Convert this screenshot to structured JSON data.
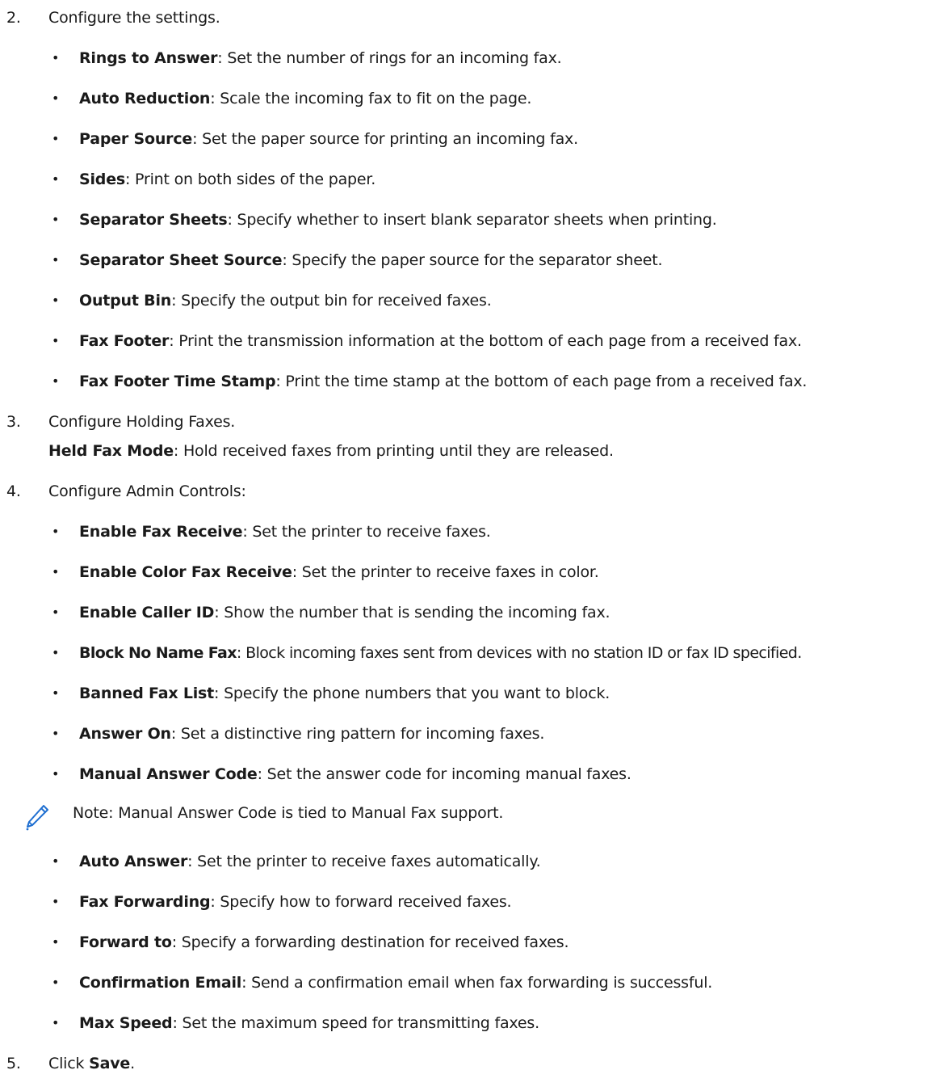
{
  "steps": [
    {
      "num": "2.",
      "text": "Configure the settings."
    },
    {
      "num": "3.",
      "text": "Configure Holding Faxes."
    },
    {
      "num": "4.",
      "text": "Configure Admin Controls:"
    },
    {
      "num": "5.",
      "text_before": "Click ",
      "term": "Save",
      "text_after": "."
    }
  ],
  "settings": [
    {
      "term": "Rings to Answer",
      "desc": ": Set the number of rings for an incoming fax."
    },
    {
      "term": "Auto Reduction",
      "desc": ": Scale the incoming fax to fit on the page."
    },
    {
      "term": "Paper Source",
      "desc": ": Set the paper source for printing an incoming fax."
    },
    {
      "term": "Sides",
      "desc": ": Print on both sides of the paper."
    },
    {
      "term": "Separator Sheets",
      "desc": ": Specify whether to insert blank separator sheets when printing."
    },
    {
      "term": "Separator Sheet Source",
      "desc": ": Specify the paper source for the separator sheet."
    },
    {
      "term": "Output Bin",
      "desc": ": Specify the output bin for received faxes."
    },
    {
      "term": "Fax Footer",
      "desc": ": Print the transmission information at the bottom of each page from a received fax."
    },
    {
      "term": "Fax Footer Time Stamp",
      "desc": ": Print the time stamp at the bottom of each page from a received fax."
    }
  ],
  "holding": {
    "term": "Held Fax Mode",
    "desc": ": Hold received faxes from printing until they are released."
  },
  "admin": [
    {
      "term": "Enable Fax Receive",
      "desc": ": Set the printer to receive faxes."
    },
    {
      "term": "Enable Color Fax Receive",
      "desc": ": Set the printer to receive faxes in color."
    },
    {
      "term": "Enable Caller ID",
      "desc": ": Show the number that is sending the incoming fax."
    },
    {
      "term": "Block No Name Fax",
      "desc": ": Block incoming faxes sent from devices with no station ID or fax ID specified."
    },
    {
      "term": "Banned Fax List",
      "desc": ": Specify the phone numbers that you want to block."
    },
    {
      "term": "Answer On",
      "desc": ": Set a distinctive ring pattern for incoming faxes."
    },
    {
      "term": "Manual Answer Code",
      "desc": ": Set the answer code for incoming manual faxes."
    }
  ],
  "note": {
    "icon": "pencil-note-icon",
    "text": "Note: Manual Answer Code is tied to Manual Fax support."
  },
  "admin_more": [
    {
      "term": "Auto Answer",
      "desc": ": Set the printer to receive faxes automatically."
    },
    {
      "term": "Fax Forwarding",
      "desc": ": Specify how to forward received faxes."
    },
    {
      "term": "Forward to",
      "desc": ": Specify a forwarding destination for received faxes."
    },
    {
      "term": "Confirmation Email",
      "desc": ": Send a confirmation email when fax forwarding is successful."
    },
    {
      "term": "Max Speed",
      "desc": ": Set the maximum speed for transmitting faxes."
    }
  ],
  "colors": {
    "text": "#1a1a1a",
    "icon": "#1f6fd1"
  },
  "bullet_char": "•"
}
